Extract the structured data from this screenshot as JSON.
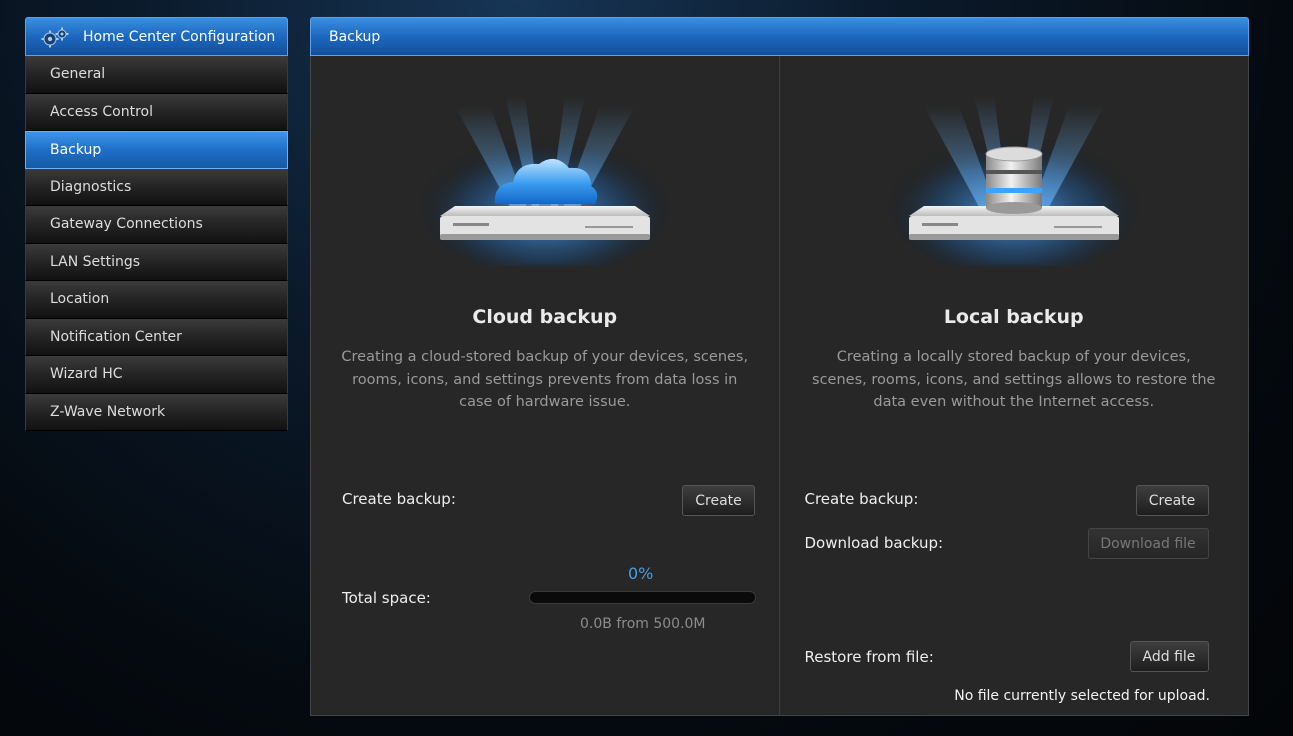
{
  "sidebar": {
    "title": "Home Center Configuration",
    "items": [
      {
        "label": "General",
        "active": false
      },
      {
        "label": "Access Control",
        "active": false
      },
      {
        "label": "Backup",
        "active": true
      },
      {
        "label": "Diagnostics",
        "active": false
      },
      {
        "label": "Gateway Connections",
        "active": false
      },
      {
        "label": "LAN Settings",
        "active": false
      },
      {
        "label": "Location",
        "active": false
      },
      {
        "label": "Notification Center",
        "active": false
      },
      {
        "label": "Wizard HC",
        "active": false
      },
      {
        "label": "Z-Wave Network",
        "active": false
      }
    ]
  },
  "panel": {
    "title": "Backup",
    "cloud": {
      "title": "Cloud backup",
      "description": "Creating a cloud-stored backup of your devices, scenes, rooms, icons, and settings prevents from data loss in case of hardware issue.",
      "create_label": "Create backup:",
      "create_button": "Create",
      "progress_percent": "0%",
      "progress_value": 0,
      "total_space_label": "Total space:",
      "space_note": "0.0B from 500.0M"
    },
    "local": {
      "title": "Local backup",
      "description": "Creating a locally stored backup of your devices, scenes, rooms, icons, and settings allows to restore the data even without the Internet access.",
      "create_label": "Create backup:",
      "create_button": "Create",
      "download_label": "Download backup:",
      "download_button": "Download file",
      "restore_label": "Restore from file:",
      "restore_button": "Add file",
      "no_file_text": "No file currently selected for upload."
    }
  },
  "colors": {
    "accent": "#1e6fc8",
    "progress_text": "#4a9ee8",
    "panel_bg": "#272727"
  }
}
